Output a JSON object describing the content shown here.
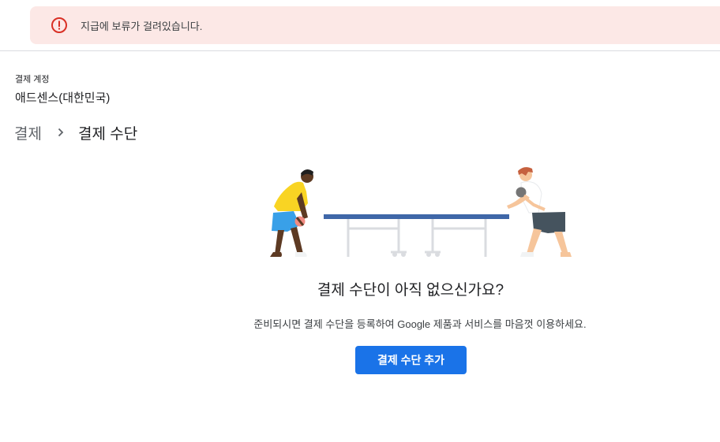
{
  "alert": {
    "message": "지급에 보류가 걸려있습니다.",
    "icon": "error-icon",
    "color": "#d93025"
  },
  "account": {
    "label": "결제 계정",
    "name": "애드센스(대한민국)"
  },
  "breadcrumb": {
    "root": "결제",
    "current": "결제 수단"
  },
  "empty_state": {
    "illustration": "ping-pong-illustration",
    "title": "결제 수단이 아직 없으신가요?",
    "description": "준비되시면 결제 수단을 등록하여 Google 제품과 서비스를 마음껏 이용하세요.",
    "button_label": "결제 수단 추가"
  },
  "colors": {
    "accent": "#1a73e8",
    "alert_background": "#fce8e6"
  }
}
